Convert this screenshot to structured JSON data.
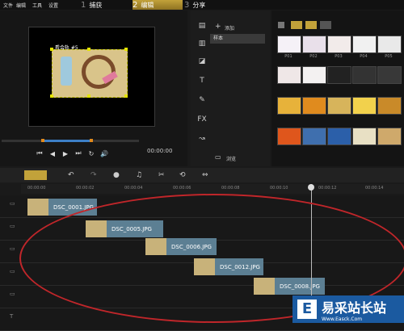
{
  "menu": [
    "文件",
    "编辑",
    "工具",
    "设置"
  ],
  "steps": [
    {
      "num": "1",
      "label": "捕获"
    },
    {
      "num": "2",
      "label": "编辑"
    },
    {
      "num": "3",
      "label": "分享"
    }
  ],
  "preview": {
    "caption": "看会轨 #5",
    "timecode": "00:00:00",
    "controls": [
      "⏮",
      "◀",
      "▶",
      "⏭",
      "↻",
      "🔊"
    ]
  },
  "options": {
    "add_label": "添加",
    "item": "样本",
    "browse_label": "浏览"
  },
  "library": {
    "thumbs": [
      {
        "label": "P01",
        "color": "#f5f1f7"
      },
      {
        "label": "P02",
        "color": "#e9e0ea"
      },
      {
        "label": "P03",
        "color": "#f2ebea"
      },
      {
        "label": "P04",
        "color": "#f1f1f1"
      },
      {
        "label": "P05",
        "color": "#e9e9e9"
      },
      {
        "label": "",
        "color": "#efe7e7"
      },
      {
        "label": "",
        "color": "#f3f1f1"
      },
      {
        "label": "",
        "color": "#222222"
      },
      {
        "label": "",
        "color": "#333333"
      },
      {
        "label": "",
        "color": "#383838"
      },
      {
        "label": "",
        "color": "#e7b23a"
      },
      {
        "label": "",
        "color": "#e08b1e"
      },
      {
        "label": "",
        "color": "#d7b45b"
      },
      {
        "label": "",
        "color": "#f2d14c"
      },
      {
        "label": "",
        "color": "#c98a29"
      },
      {
        "label": "",
        "color": "#df561c"
      },
      {
        "label": "",
        "color": "#3f6fae"
      },
      {
        "label": "",
        "color": "#2b5fa9"
      },
      {
        "label": "",
        "color": "#e8e0c4"
      },
      {
        "label": "",
        "color": "#cfa96b"
      }
    ]
  },
  "timeline": {
    "ticks": [
      "00:00:00",
      "00:00:02",
      "00:00:04",
      "00:00:06",
      "00:00:08",
      "00:00:10",
      "00:00:12",
      "00:00:14"
    ],
    "clips": [
      {
        "label": "DSC_0001.JPG"
      },
      {
        "label": "DSC_0005.JPG"
      },
      {
        "label": "DSC_0006.JPG"
      },
      {
        "label": "DSC_0012.JPG"
      },
      {
        "label": "DSC_0008.JPG"
      }
    ]
  },
  "watermark": {
    "icon": "E",
    "text": "易采站长站",
    "sub": "Www.Easck.Com"
  },
  "colors": {
    "accent": "#c2a23a",
    "clip": "#5c7f93",
    "annotation": "#c0262a"
  }
}
